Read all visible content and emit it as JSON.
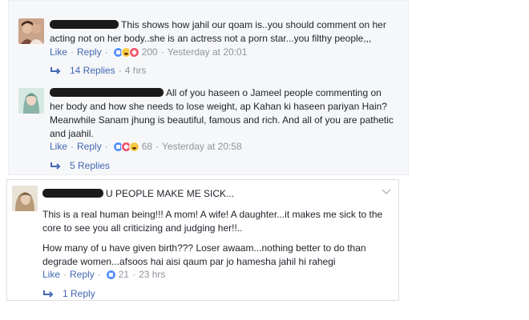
{
  "comments": [
    {
      "text": "This shows how jahil our qoam is..you should comment on her acting not on her body..she is an actress not a porn star...you filthy people,,,",
      "actions": {
        "like": "Like",
        "reply": "Reply"
      },
      "reactions": [
        "like",
        "haha",
        "love"
      ],
      "reaction_count": "200",
      "time": "Yesterday at 20:01",
      "replies": {
        "label": "14 Replies",
        "ago": "4 hrs"
      }
    },
    {
      "text": "All of you haseen o Jameel people commenting on her body and how she needs to lose weight, ap Kahan ki haseen pariyan Hain? Meanwhile Sanam jhung is beautiful, famous and rich. And all of you are pathetic and jaahil.",
      "actions": {
        "like": "Like",
        "reply": "Reply"
      },
      "reactions": [
        "like",
        "love",
        "wow"
      ],
      "reaction_count": "68",
      "time": "Yesterday at 20:58",
      "replies": {
        "label": "5 Replies"
      }
    },
    {
      "headline": "U PEOPLE MAKE ME SICK...",
      "paragraph1": "This is a real human being!!! A mom! A wife! A daughter...it makes me sick to the core to see you all criticizing and judging her!!..",
      "paragraph2": "How many of u have given birth??? Loser awaam...nothing better to do than degrade women...afsoos hai aisi qaum par jo hamesha jahil hi rahegi",
      "actions": {
        "like": "Like",
        "reply": "Reply"
      },
      "reactions": [
        "like"
      ],
      "reaction_count": "21",
      "time": "23 hrs",
      "replies": {
        "label": "1 Reply"
      }
    }
  ],
  "colors": {
    "link": "#4267b2",
    "meta": "#90949c",
    "text": "#1d2129",
    "panel": "#f6f7f9"
  },
  "icons": {
    "reply_arrow": "reply-arrow-icon",
    "options": "chevron-down-icon"
  }
}
